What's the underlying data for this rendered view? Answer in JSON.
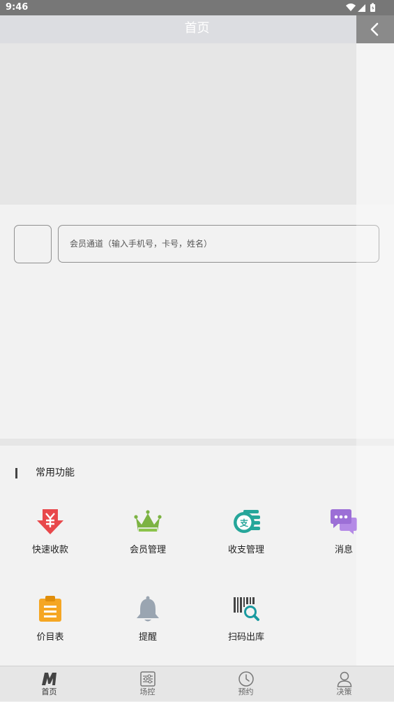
{
  "status_bar": {
    "time": "9:46",
    "icons": [
      "wifi-icon",
      "signal-icon",
      "battery-icon"
    ]
  },
  "header": {
    "title": "首页",
    "back_icon": "chevron-left-icon"
  },
  "member_search": {
    "placeholder": "会员通道（输入手机号，卡号，姓名）"
  },
  "common_functions": {
    "title": "常用功能",
    "items": [
      {
        "label": "快速收款",
        "icon": "yen-arrow-icon",
        "color": "#e8484b"
      },
      {
        "label": "会员管理",
        "icon": "crown-icon",
        "color": "#7cb342"
      },
      {
        "label": "收支管理",
        "icon": "coin-stack-icon",
        "color": "#26a69a"
      },
      {
        "label": "消息",
        "icon": "chat-bubbles-icon",
        "color": "#9c6fd6"
      },
      {
        "label": "价目表",
        "icon": "clipboard-icon",
        "color": "#f5a623"
      },
      {
        "label": "提醒",
        "icon": "bell-icon",
        "color": "#9aa5b1"
      },
      {
        "label": "扫码出库",
        "icon": "barcode-search-icon",
        "color": "#1a9aa0"
      }
    ]
  },
  "tab_bar": {
    "items": [
      {
        "label": "首页",
        "icon": "m-logo-icon",
        "active": true
      },
      {
        "label": "场控",
        "icon": "sliders-icon",
        "active": false
      },
      {
        "label": "预约",
        "icon": "clock-icon",
        "active": false
      },
      {
        "label": "决策",
        "icon": "user-icon",
        "active": false
      }
    ]
  }
}
